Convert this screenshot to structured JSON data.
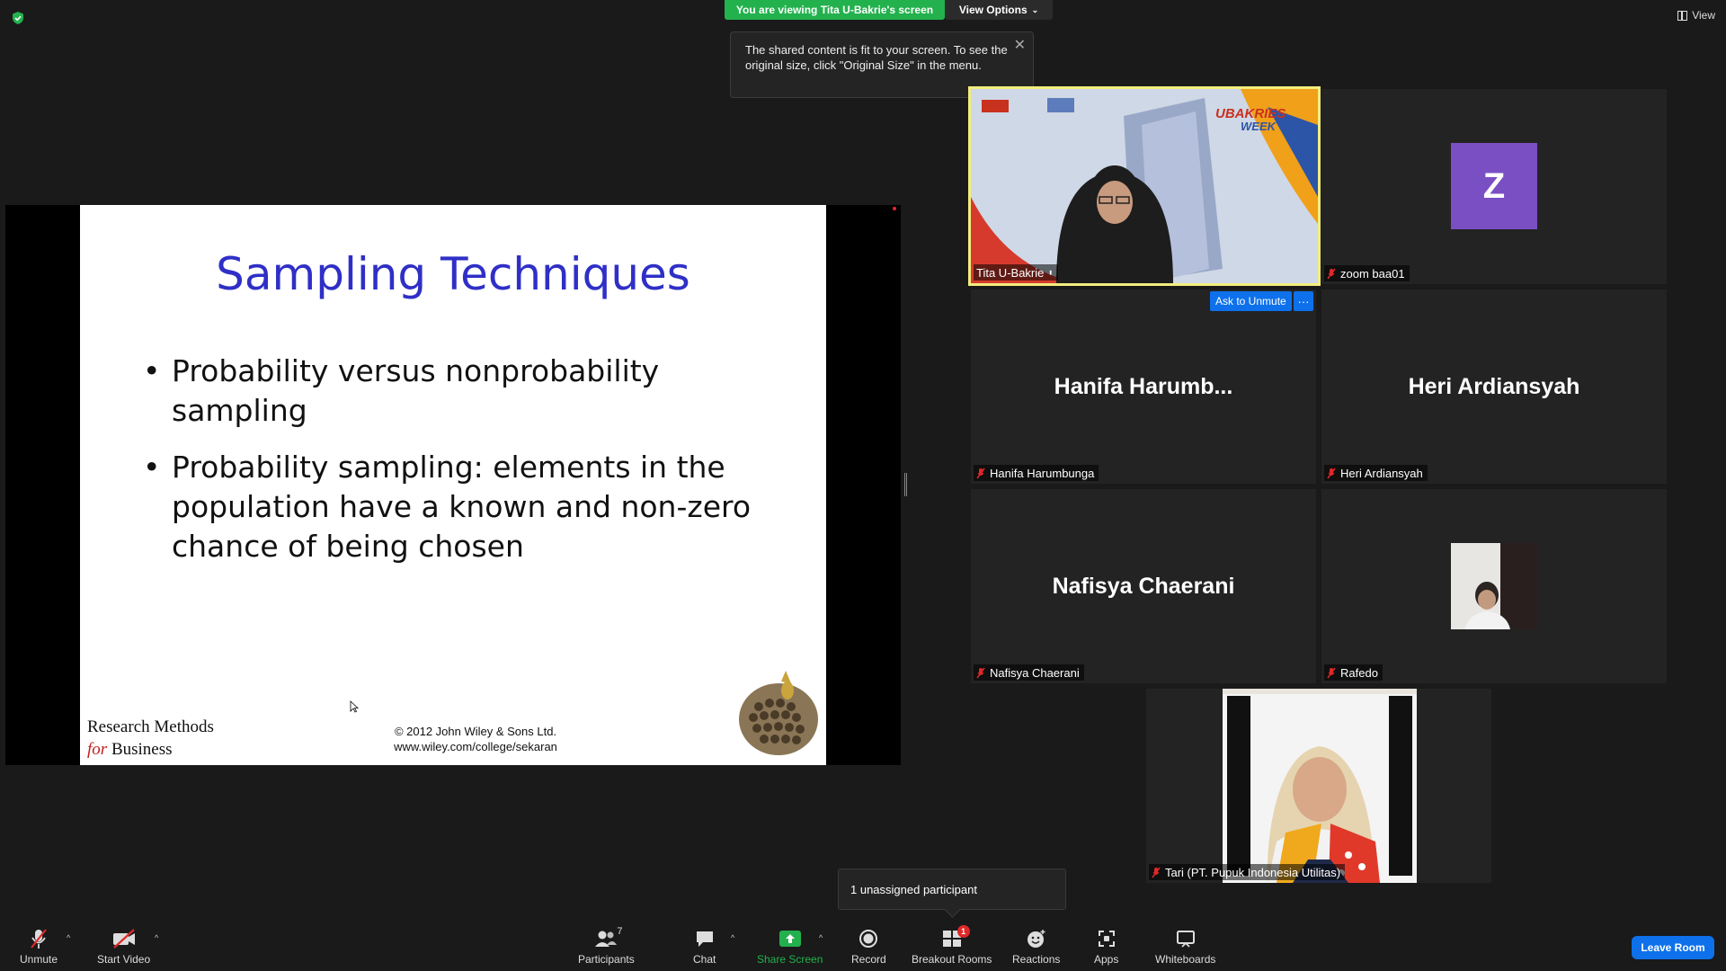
{
  "top": {
    "viewing_text": "You are viewing Tita U-Bakrie's screen",
    "view_options_label": "View Options",
    "view_label": "View"
  },
  "tooltip": {
    "text": "The shared content is fit to your screen. To see the original size, click \"Original Size\" in the menu."
  },
  "slide": {
    "title": "Sampling Techniques",
    "bullets": [
      "Probability versus nonprobability sampling",
      "Probability sampling: elements in the population have a known and non-zero chance of being chosen"
    ],
    "footer_line1": "Research Methods",
    "footer_for": "for",
    "footer_business": " Business",
    "copyright": "© 2012 John Wiley & Sons Ltd.",
    "website": "www.wiley.com/college/sekaran"
  },
  "participants": [
    {
      "name": "Tita U-Bakrie"
    },
    {
      "name": "zoom baa01",
      "initial": "Z"
    },
    {
      "name": "Hanifa Harumbunga",
      "display_name": "Hanifa  Harumb..."
    },
    {
      "name": "Heri Ardiansyah",
      "display_name": "Heri Ardiansyah"
    },
    {
      "name": "Nafisya Chaerani",
      "display_name": "Nafisya Chaerani"
    },
    {
      "name": "Rafedo"
    },
    {
      "name": "Tari (PT. Pupuk Indonesia Utilitas)"
    }
  ],
  "tile_actions": {
    "ask_to_unmute": "Ask to Unmute",
    "more": "···"
  },
  "unassigned_text": "1 unassigned participant",
  "toolbar": {
    "unmute": "Unmute",
    "start_video": "Start Video",
    "participants": "Participants",
    "participants_count": "7",
    "chat": "Chat",
    "share_screen": "Share Screen",
    "record": "Record",
    "breakout_rooms": "Breakout Rooms",
    "breakout_badge": "1",
    "reactions": "Reactions",
    "apps": "Apps",
    "whiteboards": "Whiteboards",
    "leave_room": "Leave Room"
  },
  "colors": {
    "viewing_green": "#23b14d",
    "accent_blue": "#0e71eb",
    "active_speaker": "#f2ed7e",
    "slide_title": "#2f2fc7",
    "avatar_purple": "#7a4fc4",
    "mute_red": "#e02828"
  }
}
